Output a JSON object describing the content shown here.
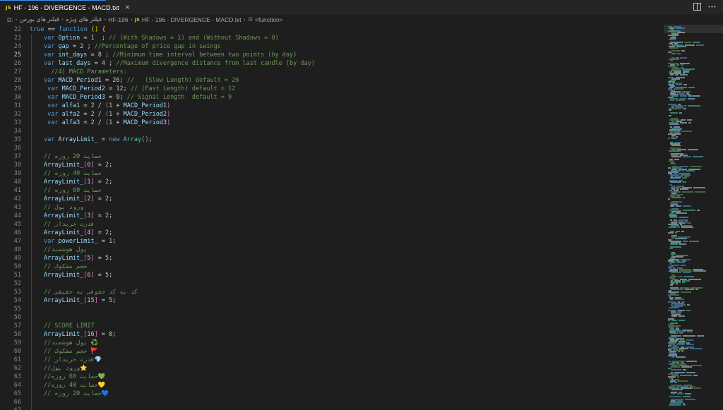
{
  "tab": {
    "badge": "JS",
    "label": "HF - 196 - DIVERGENCE - MACD.txt",
    "close": "×"
  },
  "breadcrumb": {
    "drive": "D:",
    "folder1": "فیلتر های بورس",
    "folder2": "فیلتر های ویژه",
    "folder3": "HF-196",
    "file_badge": "JS",
    "file": "HF - 196 - DIVERGENCE - MACD.txt",
    "symbol": "<function>"
  },
  "editor": {
    "active_line": 25,
    "lines": [
      {
        "n": "22",
        "indent": 0,
        "tokens": [
          [
            "keyword",
            "true"
          ],
          [
            "punct",
            " == "
          ],
          [
            "keyword",
            "function"
          ],
          [
            "punct",
            " "
          ],
          [
            "bracket",
            "()"
          ],
          [
            "punct",
            " "
          ],
          [
            "bracket",
            "{"
          ]
        ]
      },
      {
        "n": "23",
        "indent": 1,
        "tokens": [
          [
            "keyword",
            "var"
          ],
          [
            "punct",
            " "
          ],
          [
            "variable",
            "Option"
          ],
          [
            "punct",
            " = "
          ],
          [
            "number",
            "1"
          ],
          [
            "punct",
            "  ; "
          ],
          [
            "comment",
            "// (With Shadows = 1) and (Without Shadows = 0)"
          ]
        ]
      },
      {
        "n": "24",
        "indent": 1,
        "tokens": [
          [
            "keyword",
            "var"
          ],
          [
            "punct",
            " "
          ],
          [
            "variable",
            "gap"
          ],
          [
            "punct",
            " = "
          ],
          [
            "number",
            "2"
          ],
          [
            "punct",
            " ; "
          ],
          [
            "comment",
            "//Percentage of price gap in swings"
          ]
        ]
      },
      {
        "n": "25",
        "indent": 1,
        "tokens": [
          [
            "keyword",
            "var"
          ],
          [
            "punct",
            " "
          ],
          [
            "variable",
            "int_days"
          ],
          [
            "punct",
            " = "
          ],
          [
            "number",
            "8"
          ],
          [
            "punct",
            " ; "
          ],
          [
            "comment",
            "//Minimum time interval between two points (by day)"
          ]
        ]
      },
      {
        "n": "26",
        "indent": 1,
        "tokens": [
          [
            "keyword",
            "var"
          ],
          [
            "punct",
            " "
          ],
          [
            "variable",
            "last_days"
          ],
          [
            "punct",
            " = "
          ],
          [
            "number",
            "4"
          ],
          [
            "punct",
            " ; "
          ],
          [
            "comment",
            "//Maximum divergence distance from last candle (by day)"
          ]
        ]
      },
      {
        "n": "27",
        "indent": 1,
        "pad": "  ",
        "tokens": [
          [
            "comment",
            "//4) MACD Parameters:"
          ]
        ]
      },
      {
        "n": "28",
        "indent": 1,
        "tokens": [
          [
            "keyword",
            "var"
          ],
          [
            "punct",
            " "
          ],
          [
            "variable",
            "MACD_Period1"
          ],
          [
            "punct",
            " = "
          ],
          [
            "number",
            "26"
          ],
          [
            "punct",
            "; "
          ],
          [
            "comment",
            "//   (Slow Length) default = 26"
          ]
        ]
      },
      {
        "n": "29",
        "indent": 1,
        "pad": " ",
        "tokens": [
          [
            "keyword",
            "var"
          ],
          [
            "punct",
            " "
          ],
          [
            "variable",
            "MACD_Period2"
          ],
          [
            "punct",
            " = "
          ],
          [
            "number",
            "12"
          ],
          [
            "punct",
            "; "
          ],
          [
            "comment",
            "// (Fast Length) default = 12"
          ]
        ]
      },
      {
        "n": "30",
        "indent": 1,
        "pad": " ",
        "tokens": [
          [
            "keyword",
            "var"
          ],
          [
            "punct",
            " "
          ],
          [
            "variable",
            "MACD_Period3"
          ],
          [
            "punct",
            " = "
          ],
          [
            "number",
            "9"
          ],
          [
            "punct",
            "; "
          ],
          [
            "comment",
            "// Signal Length  default = 9"
          ]
        ]
      },
      {
        "n": "31",
        "indent": 1,
        "pad": " ",
        "tokens": [
          [
            "keyword",
            "var"
          ],
          [
            "punct",
            " "
          ],
          [
            "variable",
            "alfa1"
          ],
          [
            "punct",
            " = "
          ],
          [
            "number",
            "2"
          ],
          [
            "punct",
            " / "
          ],
          [
            "bracket2",
            "("
          ],
          [
            "number",
            "1"
          ],
          [
            "punct",
            " + "
          ],
          [
            "variable",
            "MACD_Period1"
          ],
          [
            "bracket2",
            ")"
          ]
        ]
      },
      {
        "n": "32",
        "indent": 1,
        "pad": " ",
        "tokens": [
          [
            "keyword",
            "var"
          ],
          [
            "punct",
            " "
          ],
          [
            "variable",
            "alfa2"
          ],
          [
            "punct",
            " = "
          ],
          [
            "number",
            "2"
          ],
          [
            "punct",
            " / "
          ],
          [
            "bracket2",
            "("
          ],
          [
            "number",
            "1"
          ],
          [
            "punct",
            " + "
          ],
          [
            "variable",
            "MACD_Period2"
          ],
          [
            "bracket2",
            ")"
          ]
        ]
      },
      {
        "n": "33",
        "indent": 1,
        "pad": " ",
        "tokens": [
          [
            "keyword",
            "var"
          ],
          [
            "punct",
            " "
          ],
          [
            "variable",
            "alfa3"
          ],
          [
            "punct",
            " = "
          ],
          [
            "number",
            "2"
          ],
          [
            "punct",
            " / "
          ],
          [
            "bracket2",
            "("
          ],
          [
            "number",
            "1"
          ],
          [
            "punct",
            " + "
          ],
          [
            "variable",
            "MACD_Period3"
          ],
          [
            "bracket2",
            ")"
          ]
        ]
      },
      {
        "n": "34",
        "indent": 1,
        "tokens": []
      },
      {
        "n": "35",
        "indent": 1,
        "tokens": [
          [
            "keyword",
            "var"
          ],
          [
            "punct",
            " "
          ],
          [
            "variable",
            "ArrayLimit_"
          ],
          [
            "punct",
            " = "
          ],
          [
            "keyword",
            "new"
          ],
          [
            "punct",
            " "
          ],
          [
            "class",
            "Array"
          ],
          [
            "bracket2",
            "()"
          ],
          [
            "punct",
            ";"
          ]
        ]
      },
      {
        "n": "36",
        "indent": 1,
        "tokens": []
      },
      {
        "n": "37",
        "indent": 1,
        "tokens": [
          [
            "comment",
            "// حمایت 20 روزه"
          ]
        ]
      },
      {
        "n": "38",
        "indent": 1,
        "tokens": [
          [
            "variable",
            "ArrayLimit_"
          ],
          [
            "bracket2",
            "["
          ],
          [
            "number",
            "0"
          ],
          [
            "bracket2",
            "]"
          ],
          [
            "punct",
            " = "
          ],
          [
            "number",
            "2"
          ],
          [
            "punct",
            ";"
          ]
        ]
      },
      {
        "n": "39",
        "indent": 1,
        "tokens": [
          [
            "comment",
            "// حمایت 40 روزه"
          ]
        ]
      },
      {
        "n": "40",
        "indent": 1,
        "tokens": [
          [
            "variable",
            "ArrayLimit_"
          ],
          [
            "bracket2",
            "["
          ],
          [
            "number",
            "1"
          ],
          [
            "bracket2",
            "]"
          ],
          [
            "punct",
            " = "
          ],
          [
            "number",
            "2"
          ],
          [
            "punct",
            ";"
          ]
        ]
      },
      {
        "n": "41",
        "indent": 1,
        "tokens": [
          [
            "comment",
            "// حمایت 60 روزه"
          ]
        ]
      },
      {
        "n": "42",
        "indent": 1,
        "tokens": [
          [
            "variable",
            "ArrayLimit_"
          ],
          [
            "bracket2",
            "["
          ],
          [
            "number",
            "2"
          ],
          [
            "bracket2",
            "]"
          ],
          [
            "punct",
            " = "
          ],
          [
            "number",
            "2"
          ],
          [
            "punct",
            ";"
          ]
        ]
      },
      {
        "n": "43",
        "indent": 1,
        "tokens": [
          [
            "comment",
            "// ورود پول"
          ]
        ]
      },
      {
        "n": "44",
        "indent": 1,
        "tokens": [
          [
            "variable",
            "ArrayLimit_"
          ],
          [
            "bracket2",
            "["
          ],
          [
            "number",
            "3"
          ],
          [
            "bracket2",
            "]"
          ],
          [
            "punct",
            " = "
          ],
          [
            "number",
            "2"
          ],
          [
            "punct",
            ";"
          ]
        ]
      },
      {
        "n": "45",
        "indent": 1,
        "tokens": [
          [
            "comment",
            "// قدرت خریدار"
          ]
        ]
      },
      {
        "n": "46",
        "indent": 1,
        "tokens": [
          [
            "variable",
            "ArrayLimit_"
          ],
          [
            "bracket2",
            "["
          ],
          [
            "number",
            "4"
          ],
          [
            "bracket2",
            "]"
          ],
          [
            "punct",
            " = "
          ],
          [
            "number",
            "2"
          ],
          [
            "punct",
            ";"
          ]
        ]
      },
      {
        "n": "47",
        "indent": 1,
        "tokens": [
          [
            "keyword",
            "var"
          ],
          [
            "punct",
            " "
          ],
          [
            "variable",
            "powerLimit_"
          ],
          [
            "punct",
            " = "
          ],
          [
            "number",
            "1"
          ],
          [
            "punct",
            ";"
          ]
        ]
      },
      {
        "n": "48",
        "indent": 1,
        "tokens": [
          [
            "comment",
            "//پول هوشمند"
          ]
        ]
      },
      {
        "n": "49",
        "indent": 1,
        "tokens": [
          [
            "variable",
            "ArrayLimit_"
          ],
          [
            "bracket2",
            "["
          ],
          [
            "number",
            "5"
          ],
          [
            "bracket2",
            "]"
          ],
          [
            "punct",
            " = "
          ],
          [
            "number",
            "5"
          ],
          [
            "punct",
            ";"
          ]
        ]
      },
      {
        "n": "50",
        "indent": 1,
        "tokens": [
          [
            "comment",
            "// حجم مشکوک"
          ]
        ]
      },
      {
        "n": "51",
        "indent": 1,
        "tokens": [
          [
            "variable",
            "ArrayLimit_"
          ],
          [
            "bracket2",
            "["
          ],
          [
            "number",
            "6"
          ],
          [
            "bracket2",
            "]"
          ],
          [
            "punct",
            " = "
          ],
          [
            "number",
            "5"
          ],
          [
            "punct",
            ";"
          ]
        ]
      },
      {
        "n": "52",
        "indent": 1,
        "tokens": []
      },
      {
        "n": "53",
        "indent": 1,
        "tokens": [
          [
            "comment",
            "// کد به کد حقوقی به حقیقی"
          ]
        ]
      },
      {
        "n": "54",
        "indent": 1,
        "tokens": [
          [
            "variable",
            "ArrayLimit_"
          ],
          [
            "bracket2",
            "["
          ],
          [
            "number",
            "15"
          ],
          [
            "bracket2",
            "]"
          ],
          [
            "punct",
            " = "
          ],
          [
            "number",
            "5"
          ],
          [
            "punct",
            ";"
          ]
        ]
      },
      {
        "n": "55",
        "indent": 1,
        "tokens": []
      },
      {
        "n": "56",
        "indent": 1,
        "tokens": []
      },
      {
        "n": "57",
        "indent": 1,
        "tokens": [
          [
            "comment",
            "// SCORE LIMIT"
          ]
        ]
      },
      {
        "n": "58",
        "indent": 1,
        "tokens": [
          [
            "variable",
            "ArrayLimit_"
          ],
          [
            "bracket2",
            "["
          ],
          [
            "number",
            "16"
          ],
          [
            "bracket2",
            "]"
          ],
          [
            "punct",
            " = "
          ],
          [
            "number",
            "0"
          ],
          [
            "punct",
            ";"
          ]
        ]
      },
      {
        "n": "59",
        "indent": 1,
        "tokens": [
          [
            "comment",
            "//پول هوشمند "
          ],
          [
            "emoji",
            "♻️"
          ]
        ]
      },
      {
        "n": "60",
        "indent": 1,
        "tokens": [
          [
            "comment",
            "// حجم مشکوک "
          ],
          [
            "emoji",
            "🚩"
          ]
        ]
      },
      {
        "n": "61",
        "indent": 1,
        "tokens": [
          [
            "comment",
            "// قدرت خریدار"
          ],
          [
            "emoji",
            "💎"
          ]
        ]
      },
      {
        "n": "62",
        "indent": 1,
        "tokens": [
          [
            "comment",
            "//ورود پول"
          ],
          [
            "emoji",
            "⭐"
          ]
        ]
      },
      {
        "n": "63",
        "indent": 1,
        "tokens": [
          [
            "comment",
            "//حمایت 60 روزه"
          ],
          [
            "emoji",
            "💚"
          ]
        ]
      },
      {
        "n": "64",
        "indent": 1,
        "tokens": [
          [
            "comment",
            "//حمایت 40 روزه"
          ],
          [
            "emoji",
            "💛"
          ]
        ]
      },
      {
        "n": "65",
        "indent": 1,
        "tokens": [
          [
            "comment",
            "// حمایت 20 روزه"
          ],
          [
            "emoji",
            "💙"
          ]
        ]
      },
      {
        "n": "66",
        "indent": 1,
        "tokens": []
      },
      {
        "n": "67",
        "indent": 1,
        "tokens": []
      }
    ]
  },
  "colors": {
    "keyword": "#569cd6",
    "variable": "#9cdcfe",
    "comment": "#6a9955",
    "number": "#b5cea8",
    "accent": "#3794ff"
  }
}
